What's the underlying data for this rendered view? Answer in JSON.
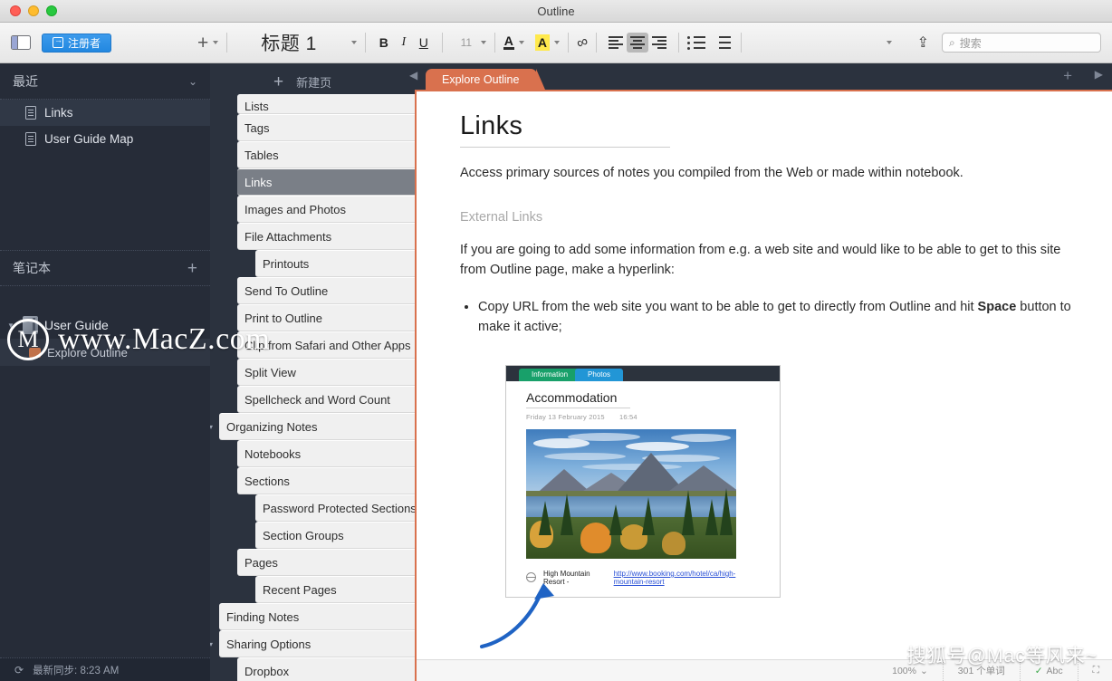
{
  "window": {
    "title": "Outline"
  },
  "toolbar": {
    "register_label": "注册者",
    "add_label": "+",
    "style_name": "标题 1",
    "bold": "B",
    "italic": "I",
    "underline": "U",
    "font_size": "11",
    "text_color_glyph": "A",
    "highlight_glyph": "A",
    "link_glyph": "∞",
    "search_placeholder": "搜索"
  },
  "sidebar": {
    "recent_header": "最近",
    "recent_items": [
      {
        "label": "Links",
        "selected": true
      },
      {
        "label": "User Guide Map",
        "selected": false
      }
    ],
    "notebooks_header": "笔记本",
    "notebook": {
      "label": "User Guide"
    },
    "section": {
      "label": "Explore Outline"
    },
    "status": "最新同步: 8:23 AM"
  },
  "tree": {
    "new_page_label": "新建页",
    "nodes": [
      {
        "label": "Lists",
        "indent": 0,
        "selected": false,
        "clipped": true
      },
      {
        "label": "Tags",
        "indent": 0,
        "selected": false
      },
      {
        "label": "Tables",
        "indent": 0,
        "selected": false
      },
      {
        "label": "Links",
        "indent": 0,
        "selected": true
      },
      {
        "label": "Images and Photos",
        "indent": 0,
        "selected": false
      },
      {
        "label": "File Attachments",
        "indent": 0,
        "selected": false
      },
      {
        "label": "Printouts",
        "indent": 1,
        "selected": false
      },
      {
        "label": "Send To Outline",
        "indent": 0,
        "selected": false
      },
      {
        "label": "Print to Outline",
        "indent": 0,
        "selected": false
      },
      {
        "label": "Clip from Safari and Other Apps",
        "indent": 0,
        "selected": false
      },
      {
        "label": "Split View",
        "indent": 0,
        "selected": false
      },
      {
        "label": "Spellcheck and Word Count",
        "indent": 0,
        "selected": false
      },
      {
        "label": "Organizing Notes",
        "indent": -1,
        "selected": false,
        "tri": "▾"
      },
      {
        "label": "Notebooks",
        "indent": 0,
        "selected": false
      },
      {
        "label": "Sections",
        "indent": 0,
        "selected": false
      },
      {
        "label": "Password Protected Sections",
        "indent": 1,
        "selected": false
      },
      {
        "label": "Section Groups",
        "indent": 1,
        "selected": false
      },
      {
        "label": "Pages",
        "indent": 0,
        "selected": false
      },
      {
        "label": "Recent Pages",
        "indent": 1,
        "selected": false
      },
      {
        "label": "Finding Notes",
        "indent": -1,
        "selected": false
      },
      {
        "label": "Sharing Options",
        "indent": -1,
        "selected": false,
        "tri": "▾"
      },
      {
        "label": "Dropbox",
        "indent": 0,
        "selected": false
      }
    ]
  },
  "document": {
    "tab_label": "Explore Outline",
    "title": "Links",
    "intro": "Access primary sources of notes you compiled from the Web or made within notebook.",
    "section_heading": "External Links",
    "paragraph": "If you are going to add some information from e.g. a web site and would like to be able to get to this site from Outline page, make a hyperlink:",
    "bullet_prefix": "Copy URL from the web site you want to be able to get to directly from Outline and hit ",
    "bullet_bold": "Space",
    "bullet_suffix": " button to make it active;",
    "screenshot": {
      "tab_information": "Information",
      "tab_photos": "Photos",
      "heading": "Accommodation",
      "date": "Friday 13 February 2015",
      "time": "16:54",
      "link_text": "High Mountain Resort - ",
      "link_url": "http://www.booking.com/hotel/ca/high-mountain-resort"
    },
    "status": {
      "zoom": "100%",
      "word_count": "301 个单词",
      "spellcheck": "Abc"
    }
  },
  "watermarks": {
    "center_logo": "M",
    "center_text": "www.MacZ.com",
    "bottom_right": "搜狐号@Mac等风来~"
  },
  "colors": {
    "accent_tab": "#d9714e",
    "register_button": "#2f92e6",
    "sidebar_bg": "#262c38",
    "highlight": "#ffe94d"
  }
}
